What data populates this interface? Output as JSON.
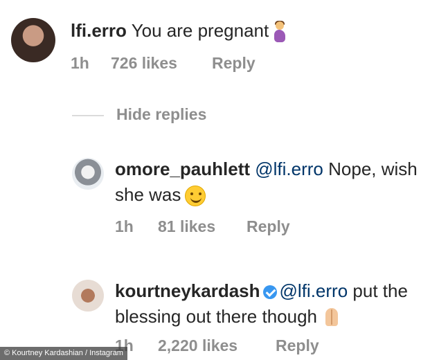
{
  "comments": [
    {
      "username": "lfi.erro",
      "mention": "",
      "text": "You are pregnant",
      "emoji": "pregnant-woman",
      "time": "1h",
      "likes": "726 likes",
      "reply": "Reply"
    },
    {
      "username": "omore_pauhlett",
      "mention": "@lfi.erro",
      "text": "Nope, wish she was",
      "emoji": "smiling-face",
      "time": "1h",
      "likes": "81 likes",
      "reply": "Reply"
    },
    {
      "username": "kourtneykardash",
      "verified": true,
      "mention": "@lfi.erro",
      "text": "put the blessing out there though",
      "emoji": "folded-hands",
      "time": "1h",
      "likes": "2,220 likes",
      "reply": "Reply"
    }
  ],
  "hide_replies": "Hide replies",
  "credit": "© Kourtney Kardashian / Instagram",
  "colors": {
    "mention": "#003569",
    "meta": "#8e8e8e",
    "verified": "#3897f0"
  }
}
